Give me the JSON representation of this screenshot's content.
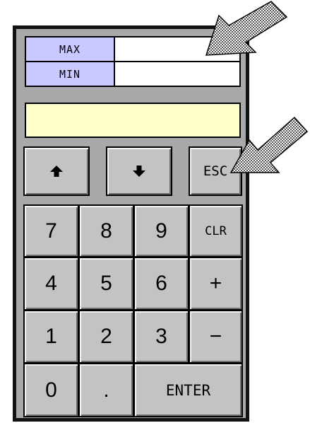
{
  "range": {
    "max_label": "MAX",
    "max_value": "",
    "min_label": "MIN",
    "min_value": ""
  },
  "display": {
    "value": ""
  },
  "keys": {
    "up": "",
    "down": "",
    "esc": "ESC",
    "k7": "7",
    "k8": "8",
    "k9": "9",
    "clr": "CLR",
    "k4": "4",
    "k5": "5",
    "k6": "6",
    "plus": "+",
    "k1": "1",
    "k2": "2",
    "k3": "3",
    "minus": "−",
    "k0": "0",
    "dot": ".",
    "enter": "ENTER"
  },
  "icons": {
    "up": "up-arrow-icon",
    "down": "down-arrow-icon",
    "callout": "callout-arrow-icon"
  },
  "colors": {
    "panel": "#a9a9a9",
    "key": "#c3c3c3",
    "range_label": "#c9c9ff",
    "display": "#ffffcc"
  }
}
